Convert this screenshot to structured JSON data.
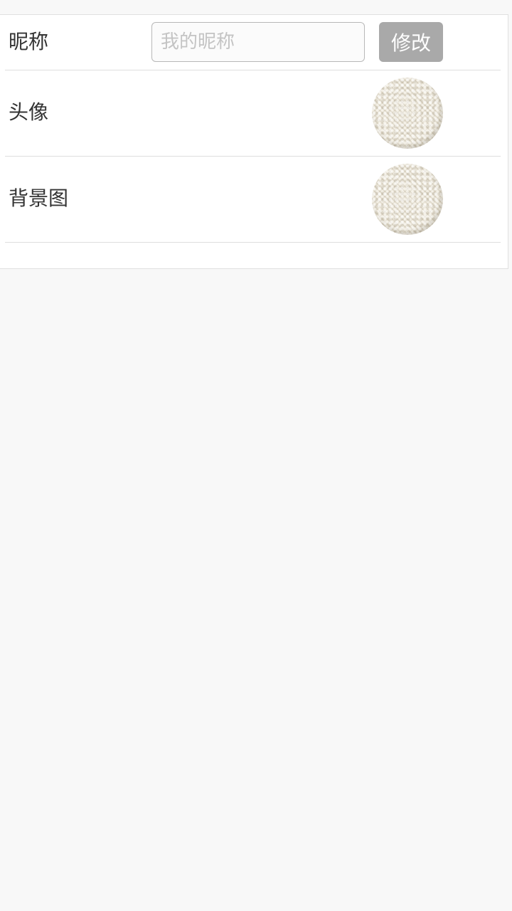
{
  "settings": {
    "nickname": {
      "label": "昵称",
      "placeholder": "我的昵称",
      "value": "",
      "button_label": "修改"
    },
    "avatar": {
      "label": "头像"
    },
    "background": {
      "label": "背景图"
    }
  },
  "colors": {
    "page_background": "#f8f8f8",
    "card_background": "#ffffff",
    "button_background": "#a9a9a9",
    "label_text": "#333333",
    "placeholder_text": "#c4c4c4"
  },
  "icons": {
    "avatar_thumb": "fabric-texture-thumbnail",
    "background_thumb": "fabric-texture-thumbnail"
  }
}
